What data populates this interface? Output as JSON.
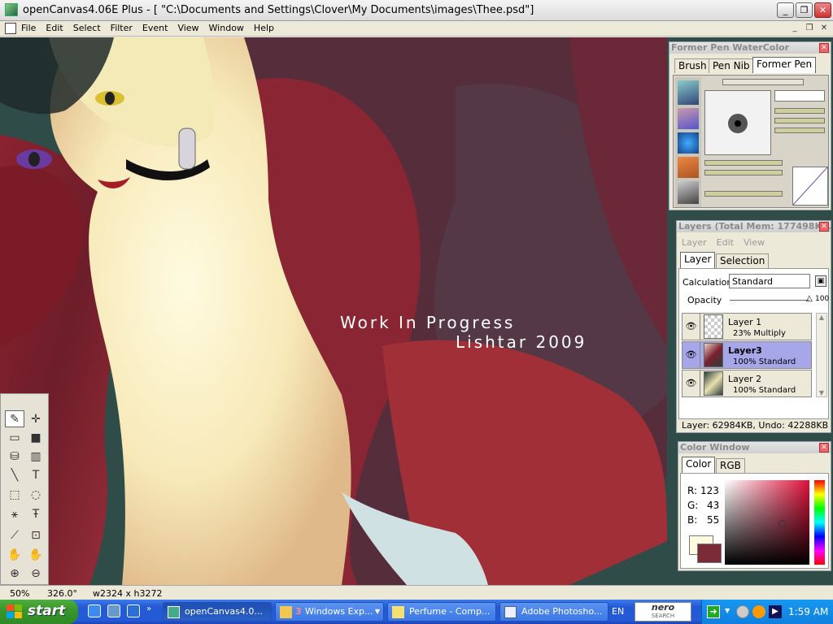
{
  "window": {
    "title": "openCanvas4.06E Plus - [ \"C:\\Documents and Settings\\Clover\\My Documents\\images\\Thee.psd\"]"
  },
  "menubar": {
    "items": [
      "File",
      "Edit",
      "Select",
      "Filter",
      "Event",
      "View",
      "Window",
      "Help"
    ]
  },
  "canvas": {
    "watermark_line1": "Work In Progress",
    "watermark_line2": "Lishtar 2009"
  },
  "brush_panel": {
    "title": "Former Pen  WaterColor",
    "tabs": [
      "Brush",
      "Pen Nib",
      "Former Pen"
    ],
    "selected_tab": "Former Pen"
  },
  "layers_panel": {
    "title": "Layers (Total Mem: 177498K...",
    "menu": [
      "Layer",
      "Edit",
      "View"
    ],
    "tabs": [
      "Layer",
      "Selection"
    ],
    "calculation_label": "Calculation",
    "calculation_value": "Standard",
    "opacity_label": "Opacity",
    "opacity_value": "100",
    "layers": [
      {
        "name": "Layer 1",
        "mode": "23% Multiply"
      },
      {
        "name": "Layer3",
        "mode": "100% Standard"
      },
      {
        "name": "Layer 2",
        "mode": "100% Standard"
      }
    ],
    "footer": "Layer: 62984KB, Undo: 42288KB"
  },
  "color_panel": {
    "title": "Color Window",
    "tabs": [
      "Color",
      "RGB"
    ],
    "r_label": "R:",
    "r_value": "123",
    "g_label": "G:",
    "g_value": "43",
    "b_label": "B:",
    "b_value": "55",
    "current_color": "#7B2B37"
  },
  "statusbar": {
    "zoom": "50%",
    "rotation": "326.0°",
    "size": "w2324 x h3272"
  },
  "taskbar": {
    "start_label": "start",
    "tasks": [
      {
        "label": "openCanvas4.0..."
      },
      {
        "label": "Windows Exp...",
        "count": "3"
      },
      {
        "label": "Perfume - Comp..."
      },
      {
        "label": "Adobe Photosho..."
      }
    ],
    "lang": "EN",
    "nero_label": "nero",
    "nero_sub": "SEARCH",
    "clock": "1:59 AM"
  }
}
